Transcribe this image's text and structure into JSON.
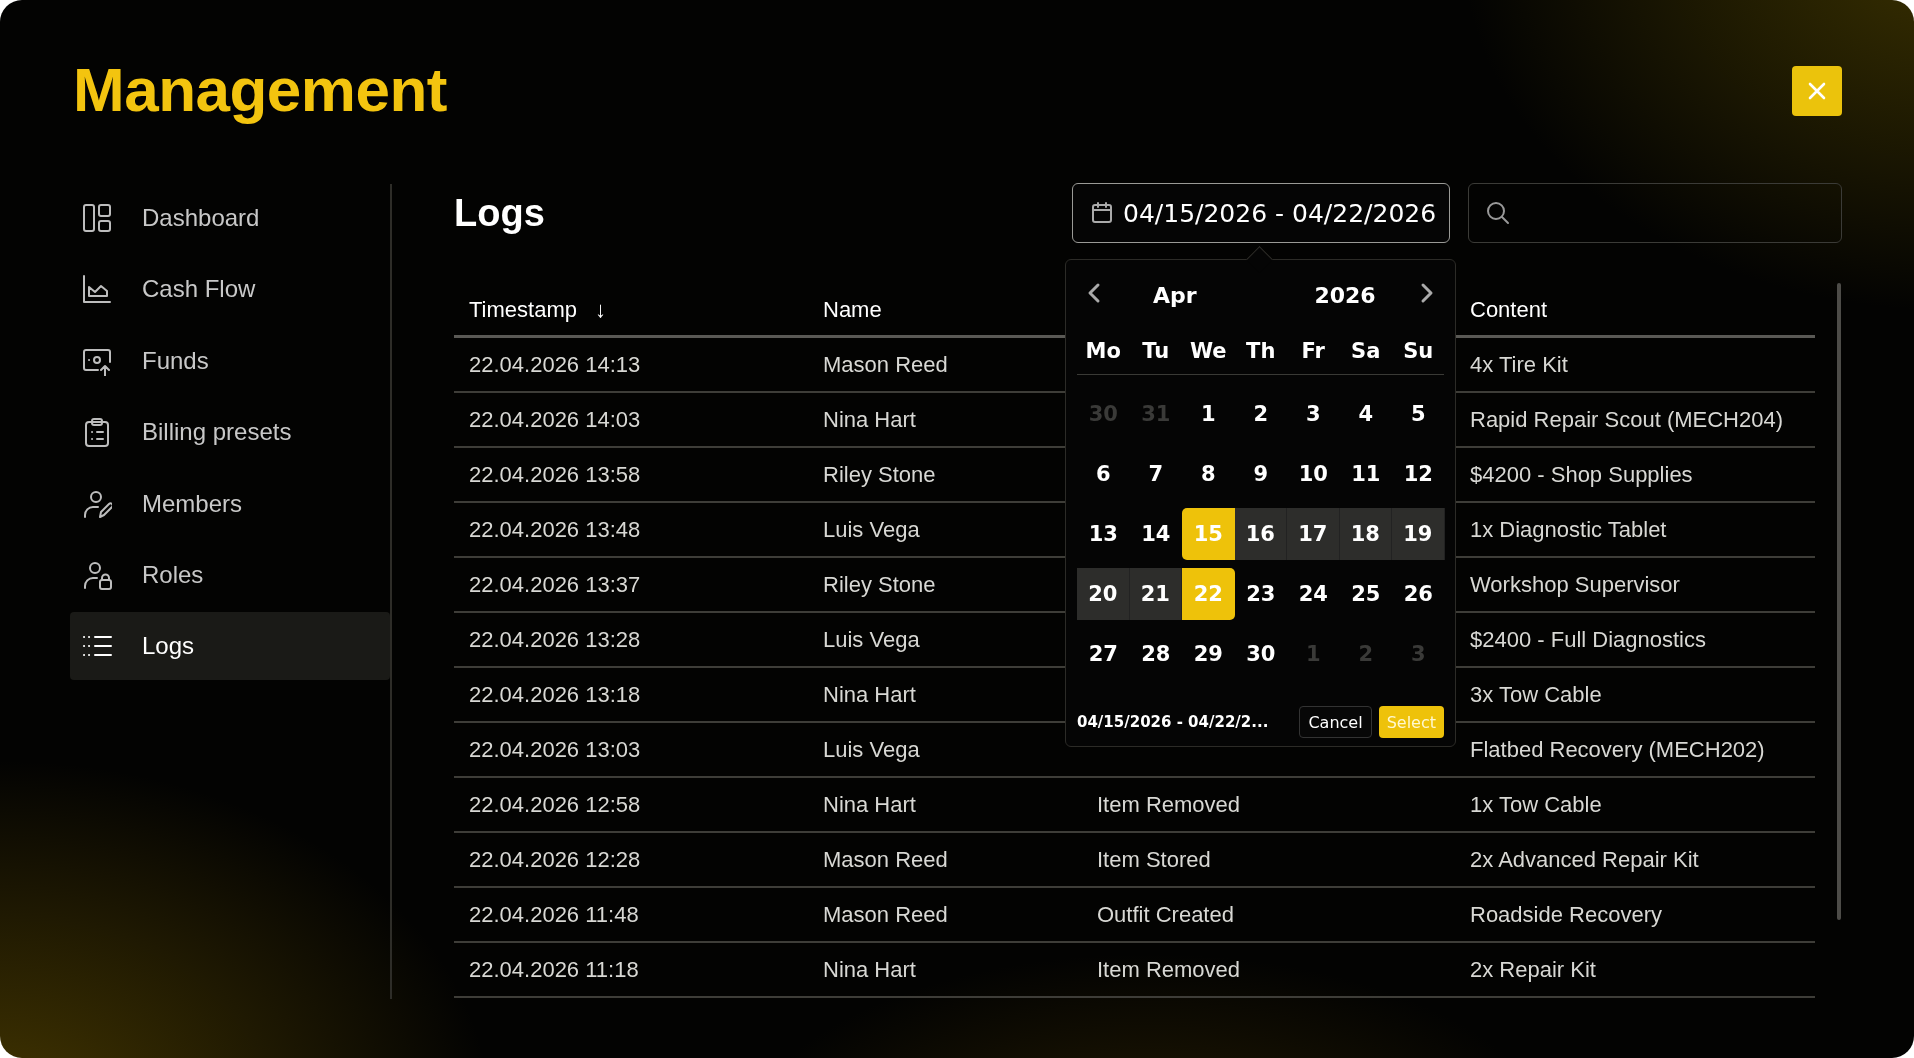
{
  "title": "Management",
  "sidebar": {
    "items": [
      {
        "label": "Dashboard",
        "selected": false
      },
      {
        "label": "Cash Flow",
        "selected": false
      },
      {
        "label": "Funds",
        "selected": false
      },
      {
        "label": "Billing presets",
        "selected": false
      },
      {
        "label": "Members",
        "selected": false
      },
      {
        "label": "Roles",
        "selected": false
      },
      {
        "label": "Logs",
        "selected": true
      }
    ]
  },
  "logs": {
    "heading": "Logs",
    "date_range": {
      "value": "04/15/2026 - 04/22/2026"
    },
    "table": {
      "columns": {
        "timestamp": {
          "label": "Timestamp",
          "sort_mark": "↓"
        },
        "name": {
          "label": "Name"
        },
        "content": {
          "label": "Content"
        }
      },
      "rows": [
        {
          "timestamp": "22.04.2026 14:13",
          "name": "Mason Reed",
          "content": "4x Tire Kit"
        },
        {
          "timestamp": "22.04.2026 14:03",
          "name": "Nina Hart",
          "content": "Rapid Repair Scout (MECH204)"
        },
        {
          "timestamp": "22.04.2026 13:58",
          "name": "Riley Stone",
          "content": "$4200 - Shop Supplies"
        },
        {
          "timestamp": "22.04.2026 13:48",
          "name": "Luis Vega",
          "content": "1x Diagnostic Tablet"
        },
        {
          "timestamp": "22.04.2026 13:37",
          "name": "Riley Stone",
          "content": "Workshop Supervisor"
        },
        {
          "timestamp": "22.04.2026 13:28",
          "name": "Luis Vega",
          "content": "$2400 - Full Diagnostics"
        },
        {
          "timestamp": "22.04.2026 13:18",
          "name": "Nina Hart",
          "content": "3x Tow Cable"
        },
        {
          "timestamp": "22.04.2026 13:03",
          "name": "Luis Vega",
          "content": "Flatbed Recovery (MECH202)"
        },
        {
          "timestamp": "22.04.2026 12:58",
          "name": "Nina Hart",
          "column_3": "Item Removed",
          "content": "1x Tow Cable"
        },
        {
          "timestamp": "22.04.2026 12:28",
          "name": "Mason Reed",
          "column_3": "Item Stored",
          "content": "2x Advanced Repair Kit"
        },
        {
          "timestamp": "22.04.2026 11:48",
          "name": "Mason Reed",
          "column_3": "Outfit Created",
          "content": "Roadside Recovery"
        },
        {
          "timestamp": "22.04.2026 11:18",
          "name": "Nina Hart",
          "column_3": "Item Removed",
          "content": "2x Repair Kit"
        }
      ]
    }
  },
  "calendar": {
    "month": "Apr",
    "year": "2026",
    "weekdays": [
      "Mo",
      "Tu",
      "We",
      "Th",
      "Fr",
      "Sa",
      "Su"
    ],
    "weeks": [
      [
        {
          "label": "30",
          "outside": true,
          "selected": false,
          "in_range": false
        },
        {
          "label": "31",
          "outside": true,
          "selected": false,
          "in_range": false
        },
        {
          "label": "1",
          "outside": false,
          "selected": false,
          "in_range": false
        },
        {
          "label": "2",
          "outside": false,
          "selected": false,
          "in_range": false
        },
        {
          "label": "3",
          "outside": false,
          "selected": false,
          "in_range": false
        },
        {
          "label": "4",
          "outside": false,
          "selected": false,
          "in_range": false
        },
        {
          "label": "5",
          "outside": false,
          "selected": false,
          "in_range": false
        }
      ],
      [
        {
          "label": "6",
          "outside": false,
          "selected": false,
          "in_range": false
        },
        {
          "label": "7",
          "outside": false,
          "selected": false,
          "in_range": false
        },
        {
          "label": "8",
          "outside": false,
          "selected": false,
          "in_range": false
        },
        {
          "label": "9",
          "outside": false,
          "selected": false,
          "in_range": false
        },
        {
          "label": "10",
          "outside": false,
          "selected": false,
          "in_range": false
        },
        {
          "label": "11",
          "outside": false,
          "selected": false,
          "in_range": false
        },
        {
          "label": "12",
          "outside": false,
          "selected": false,
          "in_range": false
        }
      ],
      [
        {
          "label": "13",
          "outside": false,
          "selected": false,
          "in_range": false
        },
        {
          "label": "14",
          "outside": false,
          "selected": false,
          "in_range": false
        },
        {
          "label": "15",
          "outside": false,
          "selected": true,
          "in_range": false
        },
        {
          "label": "16",
          "outside": false,
          "selected": false,
          "in_range": true
        },
        {
          "label": "17",
          "outside": false,
          "selected": false,
          "in_range": true
        },
        {
          "label": "18",
          "outside": false,
          "selected": false,
          "in_range": true
        },
        {
          "label": "19",
          "outside": false,
          "selected": false,
          "in_range": true
        }
      ],
      [
        {
          "label": "20",
          "outside": false,
          "selected": false,
          "in_range": true
        },
        {
          "label": "21",
          "outside": false,
          "selected": false,
          "in_range": true
        },
        {
          "label": "22",
          "outside": false,
          "selected": true,
          "in_range": false
        },
        {
          "label": "23",
          "outside": false,
          "selected": false,
          "in_range": false
        },
        {
          "label": "24",
          "outside": false,
          "selected": false,
          "in_range": false
        },
        {
          "label": "25",
          "outside": false,
          "selected": false,
          "in_range": false
        },
        {
          "label": "26",
          "outside": false,
          "selected": false,
          "in_range": false
        }
      ],
      [
        {
          "label": "27",
          "outside": false,
          "selected": false,
          "in_range": false
        },
        {
          "label": "28",
          "outside": false,
          "selected": false,
          "in_range": false
        },
        {
          "label": "29",
          "outside": false,
          "selected": false,
          "in_range": false
        },
        {
          "label": "30",
          "outside": false,
          "selected": false,
          "in_range": false
        },
        {
          "label": "1",
          "outside": true,
          "selected": false,
          "in_range": false
        },
        {
          "label": "2",
          "outside": true,
          "selected": false,
          "in_range": false
        },
        {
          "label": "3",
          "outside": true,
          "selected": false,
          "in_range": false
        }
      ]
    ],
    "footer_range": "04/15/2026 - 04/22/2...",
    "buttons": {
      "cancel": "Cancel",
      "select": "Select"
    }
  }
}
